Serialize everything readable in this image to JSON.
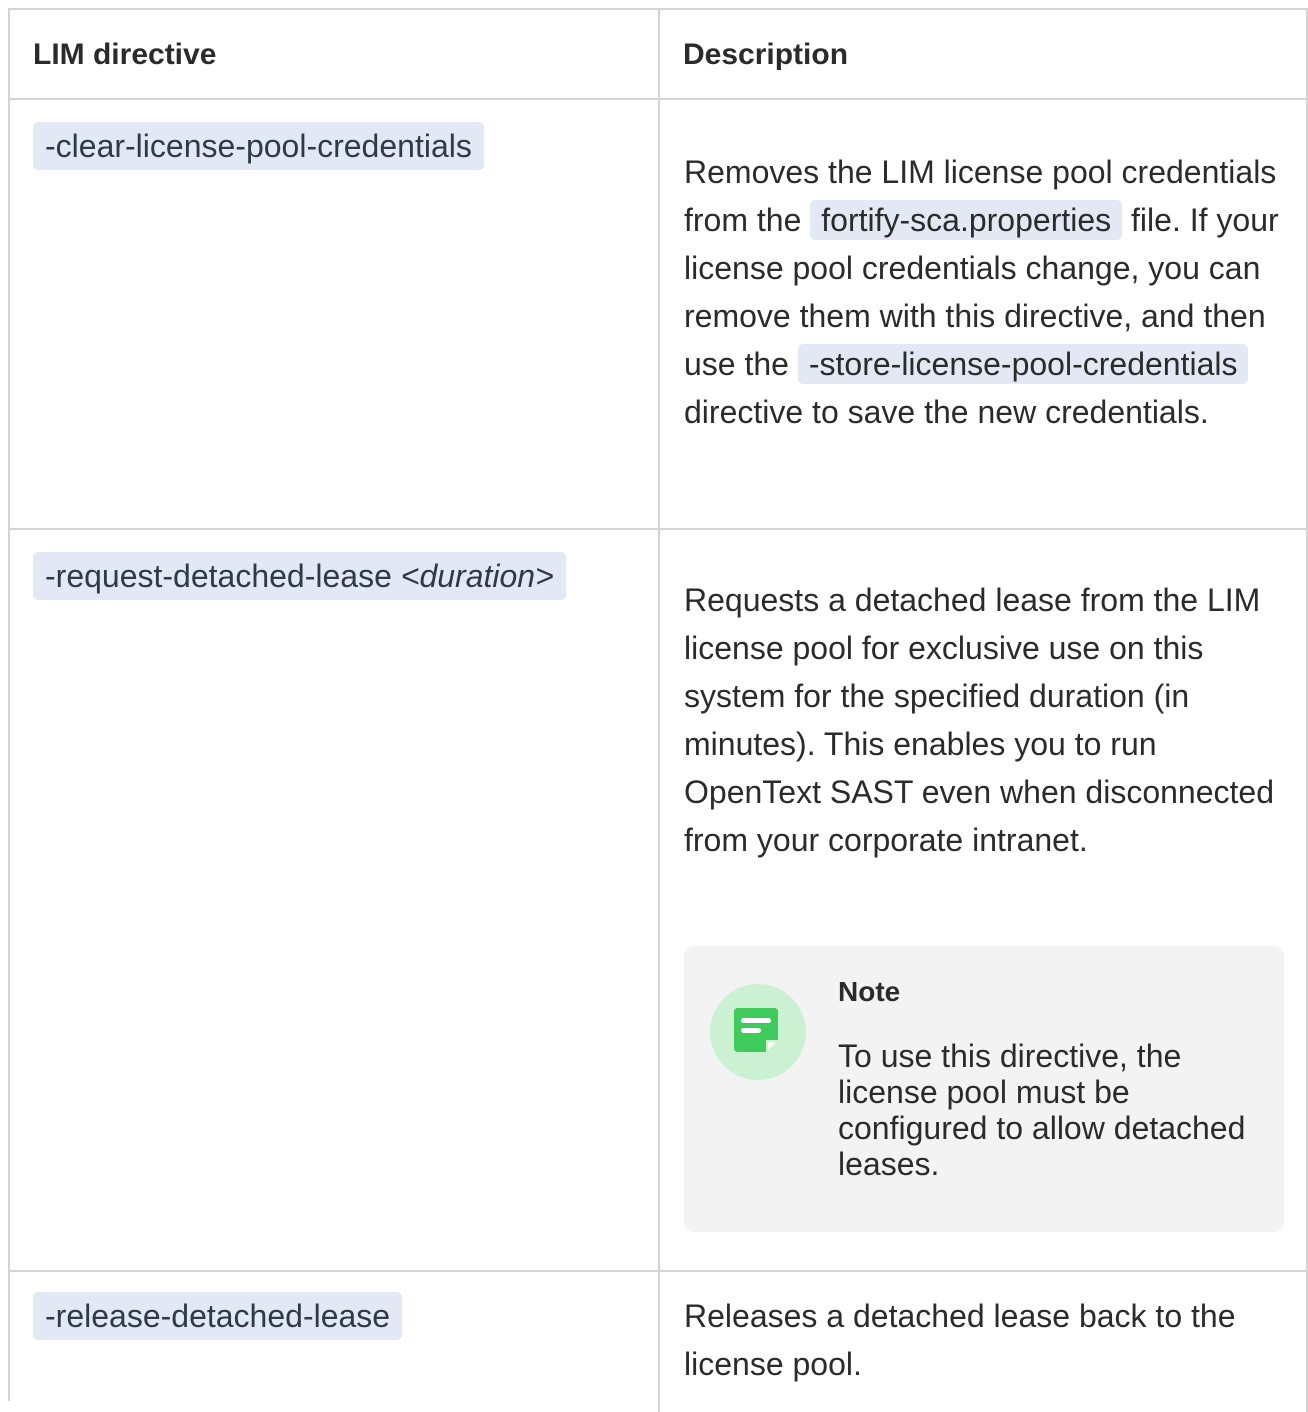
{
  "table": {
    "headers": {
      "directive": "LIM directive",
      "description": "Description"
    },
    "rows": [
      {
        "directive": "-clear-license-pool-credentials",
        "desc_part1": "Removes the LIM license pool credentials from the ",
        "desc_code1": "fortify-sca.properties",
        "desc_part2": " file. If your license pool credentials change, you can remove them with this directive, and then use the ",
        "desc_code2": "-store-license-pool-credentials",
        "desc_part3": " directive to save the new credentials."
      },
      {
        "directive": "-request-detached-lease ",
        "directive_param": "<duration>",
        "desc": "Requests a detached lease from the LIM license pool for exclusive use on this system for the specified duration (in minutes). This enables you to run OpenText SAST even when disconnected from your corporate intranet.",
        "note": {
          "title": "Note",
          "text": "To use this directive, the license pool must be configured to allow detached leases.",
          "icon": "note-icon"
        }
      },
      {
        "directive": "-release-detached-lease",
        "desc": "Releases a detached lease back to the license pool."
      }
    ]
  },
  "colors": {
    "code_background": "#e3e9f4",
    "note_background": "#f3f3f3",
    "note_icon_green": "#3ecb5c",
    "note_icon_circle": "#ccf0d2",
    "border": "#d4d4d4"
  }
}
